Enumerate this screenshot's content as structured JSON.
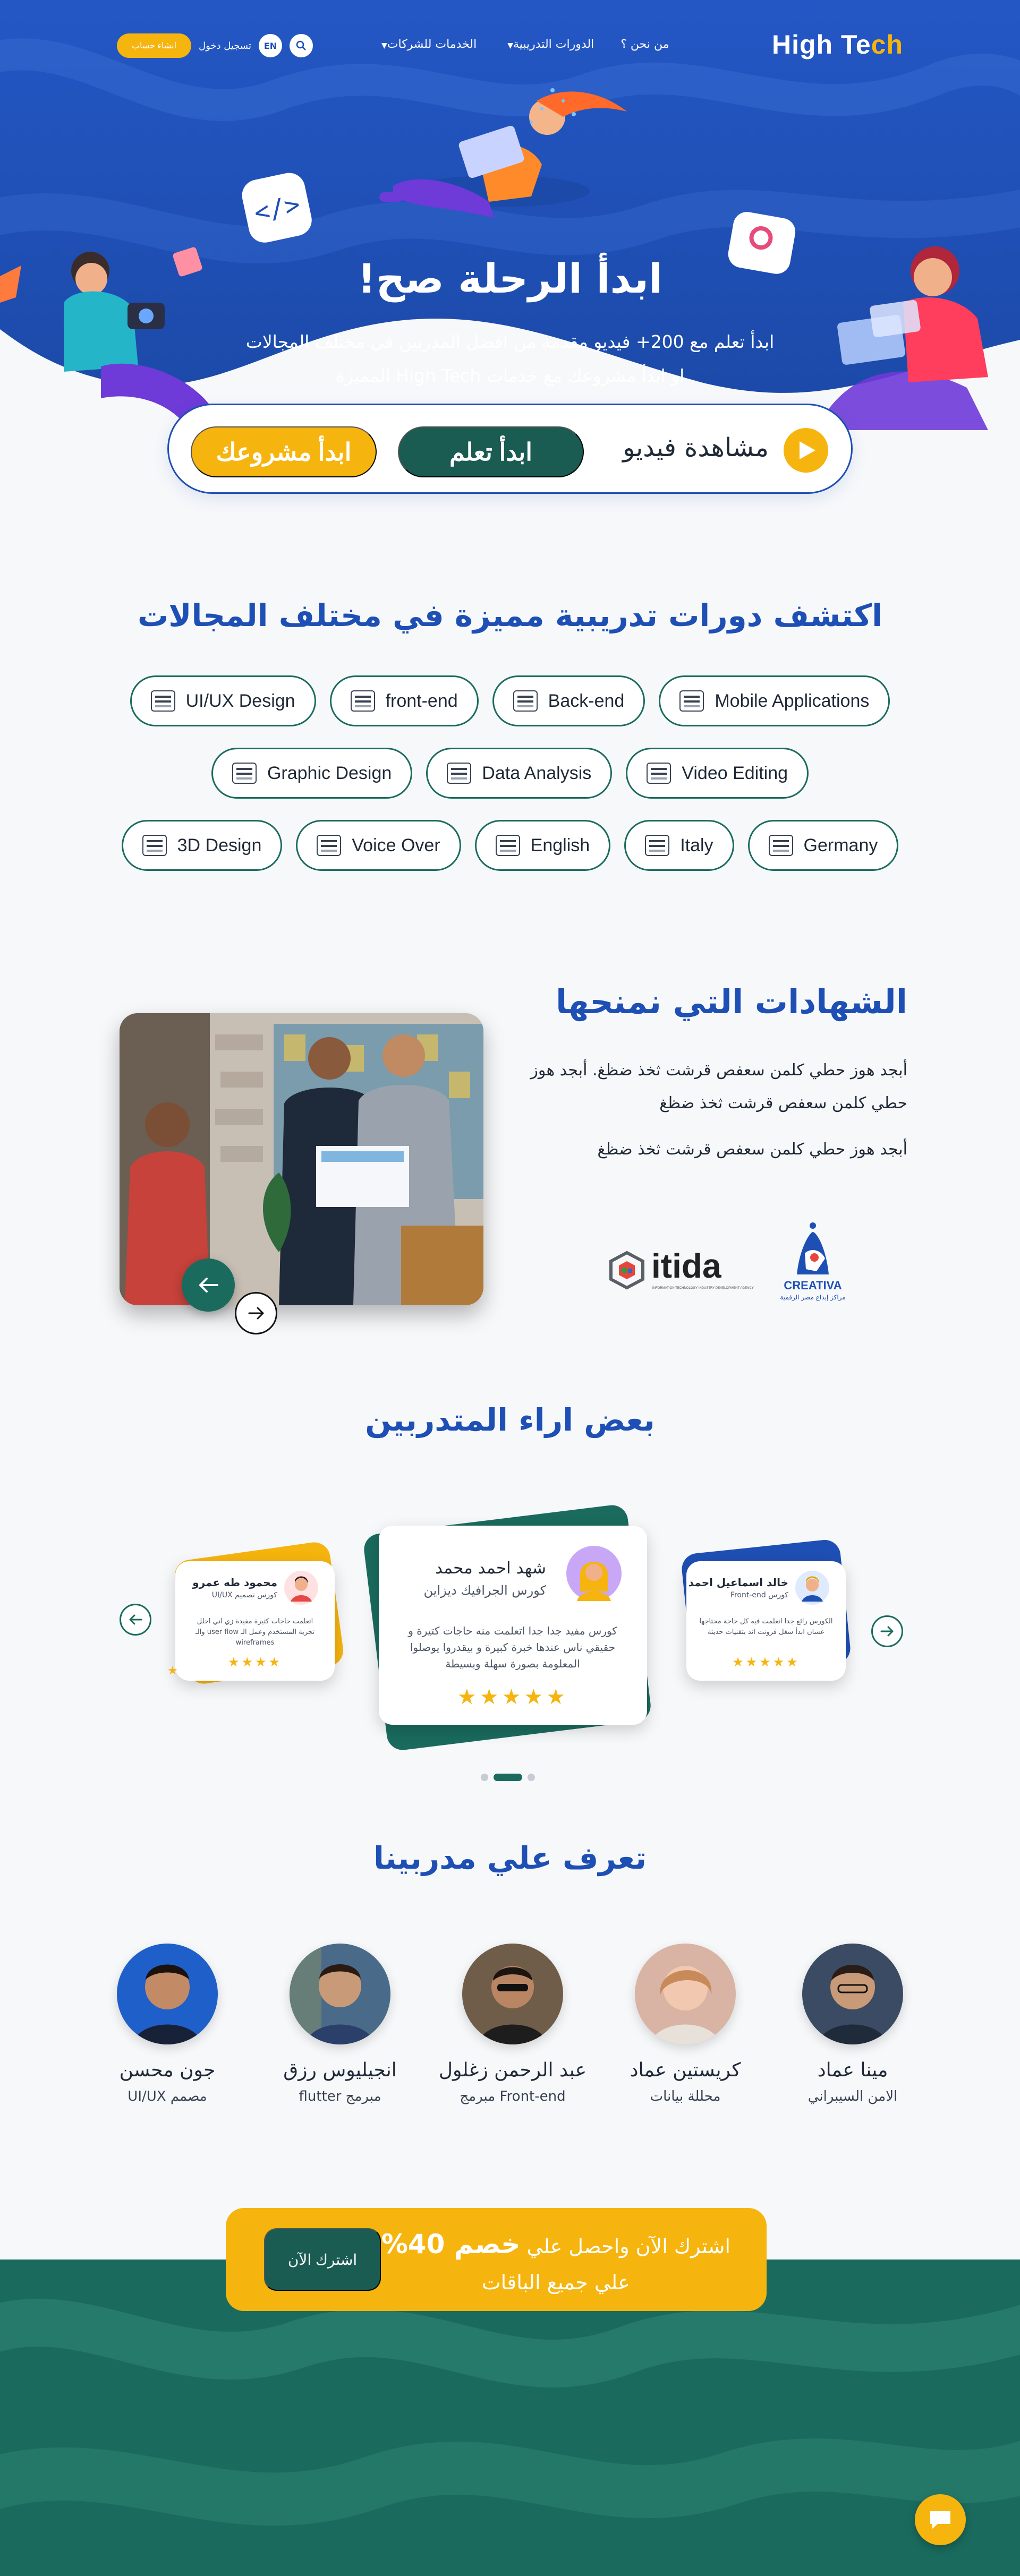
{
  "nav": {
    "logo_main": "High Te",
    "logo_accent": "ch",
    "links": [
      {
        "label": "من نحن ؟",
        "dropdown": false
      },
      {
        "label": "الدورات التدريبية",
        "dropdown": true
      },
      {
        "label": "الخدمات للشركات",
        "dropdown": true
      }
    ],
    "create_account": "انشاء حساب",
    "login": "تسجيل دخول",
    "language": "EN",
    "search_icon": "search-icon"
  },
  "hero": {
    "title": "ابدأ الرحلة صح!",
    "subtitle_line1": "ابدأ تعلم مع 200+ فيديو مقدمة من افضل المدربين  في مختلف المجالات",
    "subtitle_line2": "او ابدأ مشروعك مع خدمات High Tech المميزة",
    "watch_video": "مشاهدة فيديو",
    "start_learning": "ابدأ تعلم",
    "start_project": "ابدأ مشروعك"
  },
  "courses": {
    "title": "اكتشف دورات تدريبية مميزة في مختلف المجالات",
    "rows": [
      [
        "UI/UX Design",
        "front-end",
        "Back-end",
        "Mobile Applications"
      ],
      [
        "Graphic Design",
        "Data Analysis",
        "Video Editing"
      ],
      [
        "3D Design",
        "Voice Over",
        "English",
        "Italy",
        "Germany"
      ]
    ]
  },
  "certificates": {
    "title": "الشهادات التي نمنحها",
    "p1": "أبجد هوز حطي كلمن سعفص قرشت ثخذ ضظغ. أبجد هوز حطي كلمن سعفص قرشت ثخذ ضظغ",
    "p2": "أبجد هوز حطي كلمن سعفص قرشت ثخذ ضظغ",
    "partner1": "itida",
    "partner1_tag": "INFORMATION TECHNOLOGY INDUSTRY DEVELOPMENT AGENCY",
    "partner2": "CREATIVA",
    "partner2_tag": "مراكز إبداع مصر الرقمية"
  },
  "testimonials": {
    "title": "بعض اراء المتدربين",
    "featured": {
      "name": "شهد احمد محمد",
      "course": "كورس الجرافيك ديزاين",
      "text": "كورس مفيد جدا جدا اتعلمت منه حاجات كتيرة و حقيقي ناس عندها خبرة كبيرة و بيقدروا يوصلوا المعلومة بصورة سهلة وبسيطة",
      "stars": "★★★★★"
    },
    "left": {
      "name": "محمود طه عمرو",
      "course": "كورس تصميم UI/UX",
      "text": "اتعلمت حاجات كتيرة مفيدة زي اني احلل تجربة المستخدم وعمل الـ user flow والـ wireframes",
      "stars": "★★★★"
    },
    "right": {
      "name": "خالد اسماعيل احمد",
      "course": "كورس Front-end",
      "text": "الكورس رائع جدا اتعلمت فيه كل حاجة محتاجها عشان ابدأ شغل فرونت اند بتقنيات حديثة",
      "stars": "★★★★★"
    }
  },
  "trainers": {
    "title": "تعرف علي مدربينا",
    "list": [
      {
        "name": "مينا عماد",
        "role": "الامن السيبراني"
      },
      {
        "name": "كريستين عماد",
        "role": "محللة بيانات"
      },
      {
        "name": "عبد الرحمن زغلول",
        "role": "Front-end مبرمج"
      },
      {
        "name": "انجيليوس رزق",
        "role": "مبرمج flutter"
      },
      {
        "name": "جون محسن",
        "role": "مصمم UI/UX"
      }
    ]
  },
  "promo": {
    "line1_a": "اشترك الآن واحصل علي",
    "line1_b": "خصم 40%",
    "line2": "علي جميع الباقات",
    "button": "اشترك الآن"
  },
  "colors": {
    "primary_blue": "#1e4fb4",
    "accent_yellow": "#f6b40e",
    "dark_green": "#1a5c52",
    "teal": "#1a6b5e"
  }
}
